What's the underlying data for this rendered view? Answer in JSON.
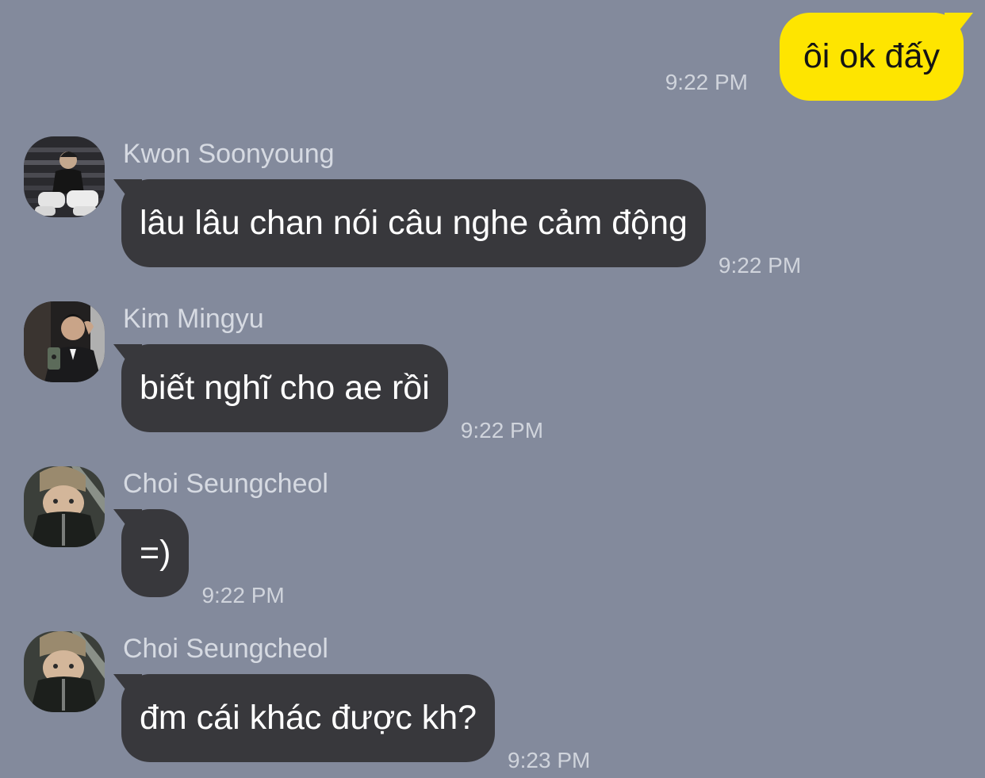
{
  "outgoing": {
    "text": "ôi ok đấy",
    "time": "9:22 PM",
    "bubble_color": "#fee500"
  },
  "messages": [
    {
      "sender": "Kwon Soonyoung",
      "text": "lâu lâu chan nói câu nghe cảm động",
      "time": "9:22 PM",
      "avatar": "person-sitting-on-stairs-photo"
    },
    {
      "sender": "Kim Mingyu",
      "text": "biết nghĩ cho ae rồi",
      "time": "9:22 PM",
      "avatar": "mirror-selfie-in-suit-photo"
    },
    {
      "sender": "Choi Seungcheol",
      "text": "=)",
      "time": "9:22 PM",
      "avatar": "person-in-car-photo"
    },
    {
      "sender": "Choi Seungcheol",
      "text": "đm cái khác được kh?",
      "time": "9:23 PM",
      "avatar": "person-in-car-photo"
    }
  ],
  "colors": {
    "background": "#838a9c",
    "incoming_bubble": "#38383c",
    "outgoing_bubble": "#fee500"
  }
}
